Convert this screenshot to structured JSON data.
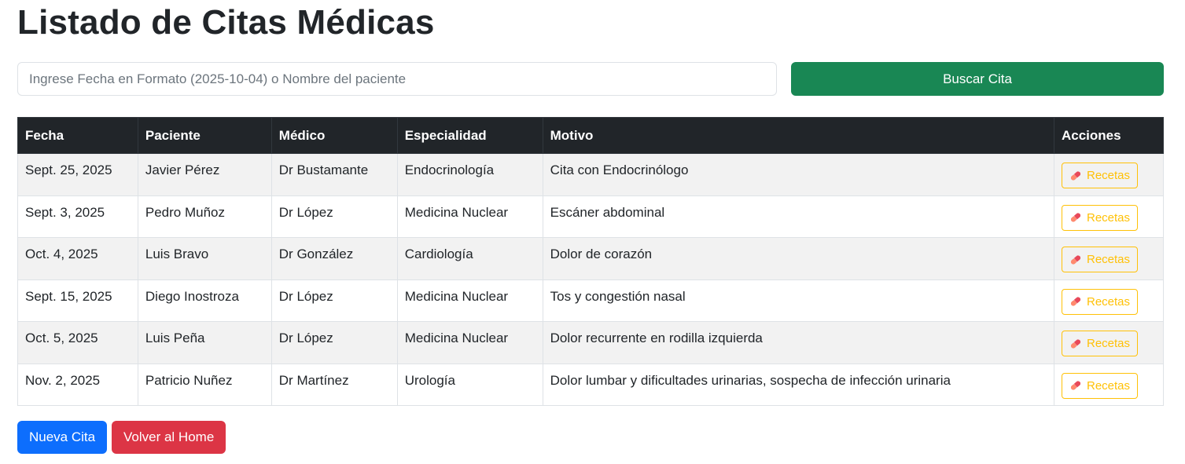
{
  "page": {
    "title": "Listado de Citas Médicas"
  },
  "search": {
    "placeholder": "Ingrese Fecha en Formato (2025-10-04) o Nombre del paciente",
    "value": "",
    "button_label": "Buscar Cita"
  },
  "table": {
    "headers": [
      "Fecha",
      "Paciente",
      "Médico",
      "Especialidad",
      "Motivo",
      "Acciones"
    ],
    "action_label": "Recetas",
    "action_icon": "pill-icon",
    "rows": [
      {
        "fecha": "Sept. 25, 2025",
        "paciente": "Javier Pérez",
        "medico": "Dr Bustamante",
        "especialidad": "Endocrinología",
        "motivo": "Cita con Endocrinólogo"
      },
      {
        "fecha": "Sept. 3, 2025",
        "paciente": "Pedro Muñoz",
        "medico": "Dr López",
        "especialidad": "Medicina Nuclear",
        "motivo": "Escáner abdominal"
      },
      {
        "fecha": "Oct. 4, 2025",
        "paciente": "Luis Bravo",
        "medico": "Dr González",
        "especialidad": "Cardiología",
        "motivo": "Dolor de corazón"
      },
      {
        "fecha": "Sept. 15, 2025",
        "paciente": "Diego Inostroza",
        "medico": "Dr López",
        "especialidad": "Medicina Nuclear",
        "motivo": "Tos y congestión nasal"
      },
      {
        "fecha": "Oct. 5, 2025",
        "paciente": "Luis Peña",
        "medico": "Dr López",
        "especialidad": "Medicina Nuclear",
        "motivo": "Dolor recurrente en rodilla izquierda"
      },
      {
        "fecha": "Nov. 2, 2025",
        "paciente": "Patricio Nuñez",
        "medico": "Dr Martínez",
        "especialidad": "Urología",
        "motivo": "Dolor lumbar y dificultades urinarias, sospecha de infección urinaria"
      }
    ]
  },
  "footer": {
    "new_label": "Nueva Cita",
    "home_label": "Volver al Home"
  },
  "colors": {
    "search_button": "#198754",
    "header_bg": "#212529",
    "action_outline": "#ffc107",
    "new_button": "#0d6efd",
    "home_button": "#dc3545"
  }
}
